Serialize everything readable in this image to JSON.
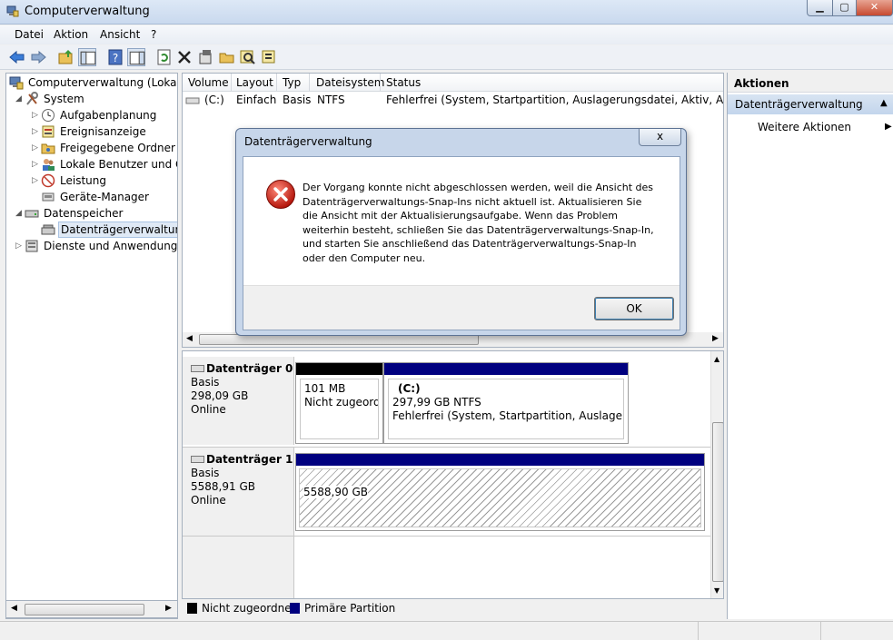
{
  "window": {
    "title": "Computerverwaltung",
    "min_glyph": "▁",
    "max_glyph": "▢",
    "close_glyph": "✕"
  },
  "menu": {
    "items": [
      "Datei",
      "Aktion",
      "Ansicht",
      "?"
    ]
  },
  "toolbar": {
    "icons": [
      "back-icon",
      "forward-icon",
      "up-icon",
      "show-tree-icon",
      "help-icon",
      "properties-icon",
      "refresh-icon",
      "delete-icon",
      "settings-icon",
      "open-icon",
      "search-icon",
      "info-icon"
    ]
  },
  "tree": {
    "root": "Computerverwaltung (Lokal)",
    "system": "System",
    "system_items": [
      "Aufgabenplanung",
      "Ereignisanzeige",
      "Freigegebene Ordner",
      "Lokale Benutzer und Gr",
      "Leistung",
      "Geräte-Manager"
    ],
    "storage": "Datenspeicher",
    "storage_items": [
      "Datenträgerverwaltung"
    ],
    "services": "Dienste und Anwendungen"
  },
  "volume_list": {
    "columns": [
      "Volume",
      "Layout",
      "Typ",
      "Dateisystem",
      "Status"
    ],
    "rows": [
      {
        "volume": "(C:)",
        "layout": "Einfach",
        "typ": "Basis",
        "fs": "NTFS",
        "status": "Fehlerfrei (System, Startpartition, Auslagerungsdatei, Aktiv, Absturzabb"
      }
    ]
  },
  "disks": [
    {
      "name": "Datenträger 0",
      "type": "Basis",
      "size": "298,09 GB",
      "state": "Online",
      "partitions": [
        {
          "line1": "",
          "line2": "101 MB",
          "line3": "Nicht zugeordn"
        },
        {
          "line1": "(C:)",
          "line2": "297,99 GB NTFS",
          "line3": "Fehlerfrei (System, Startpartition, Auslagerungsd"
        }
      ]
    },
    {
      "name": "Datenträger 1",
      "type": "Basis",
      "size": "5588,91 GB",
      "state": "Online",
      "partitions": [
        {
          "line2": "5588,90 GB"
        }
      ]
    }
  ],
  "legend": {
    "unallocated": "Nicht zugeordnet",
    "primary": "Primäre Partition"
  },
  "colors": {
    "unallocated": "#000000",
    "primary": "#00007f",
    "selection": "#dfe9f5"
  },
  "actions": {
    "title": "Aktionen",
    "group": "Datenträgerverwaltung",
    "item": "Weitere Aktionen"
  },
  "dialog": {
    "title": "Datenträgerverwaltung",
    "close_glyph": "x",
    "message": "Der Vorgang konnte nicht abgeschlossen werden, weil die Ansicht des Datenträgerverwaltungs-Snap-Ins nicht aktuell ist. Aktualisieren Sie die Ansicht mit der Aktualisierungsaufgabe. Wenn das Problem weiterhin besteht, schließen Sie das Datenträgerverwaltungs-Snap-In, und starten Sie anschließend das Datenträgerverwaltungs-Snap-In oder den Computer neu.",
    "ok": "OK"
  }
}
